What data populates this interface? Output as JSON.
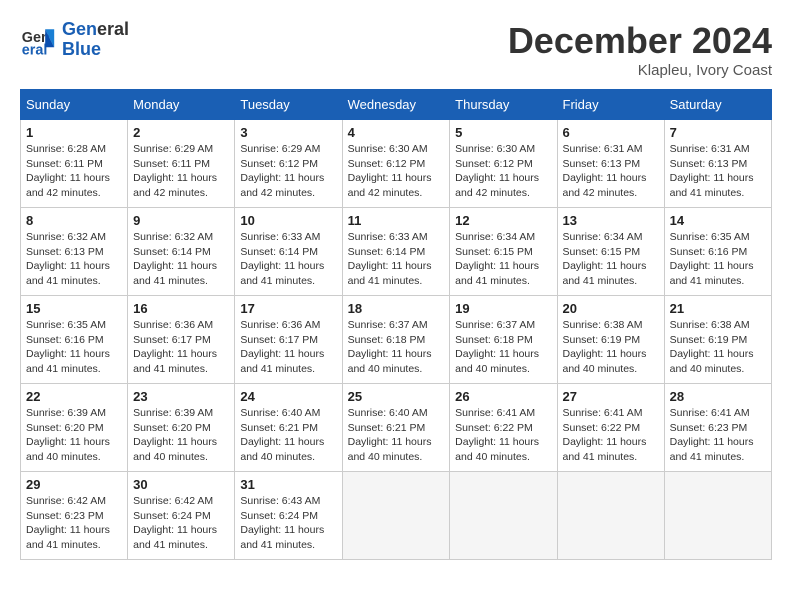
{
  "header": {
    "logo_line1": "General",
    "logo_line2": "Blue",
    "month_title": "December 2024",
    "location": "Klapleu, Ivory Coast"
  },
  "weekdays": [
    "Sunday",
    "Monday",
    "Tuesday",
    "Wednesday",
    "Thursday",
    "Friday",
    "Saturday"
  ],
  "weeks": [
    [
      {
        "day": "1",
        "info": "Sunrise: 6:28 AM\nSunset: 6:11 PM\nDaylight: 11 hours\nand 42 minutes."
      },
      {
        "day": "2",
        "info": "Sunrise: 6:29 AM\nSunset: 6:11 PM\nDaylight: 11 hours\nand 42 minutes."
      },
      {
        "day": "3",
        "info": "Sunrise: 6:29 AM\nSunset: 6:12 PM\nDaylight: 11 hours\nand 42 minutes."
      },
      {
        "day": "4",
        "info": "Sunrise: 6:30 AM\nSunset: 6:12 PM\nDaylight: 11 hours\nand 42 minutes."
      },
      {
        "day": "5",
        "info": "Sunrise: 6:30 AM\nSunset: 6:12 PM\nDaylight: 11 hours\nand 42 minutes."
      },
      {
        "day": "6",
        "info": "Sunrise: 6:31 AM\nSunset: 6:13 PM\nDaylight: 11 hours\nand 42 minutes."
      },
      {
        "day": "7",
        "info": "Sunrise: 6:31 AM\nSunset: 6:13 PM\nDaylight: 11 hours\nand 41 minutes."
      }
    ],
    [
      {
        "day": "8",
        "info": "Sunrise: 6:32 AM\nSunset: 6:13 PM\nDaylight: 11 hours\nand 41 minutes."
      },
      {
        "day": "9",
        "info": "Sunrise: 6:32 AM\nSunset: 6:14 PM\nDaylight: 11 hours\nand 41 minutes."
      },
      {
        "day": "10",
        "info": "Sunrise: 6:33 AM\nSunset: 6:14 PM\nDaylight: 11 hours\nand 41 minutes."
      },
      {
        "day": "11",
        "info": "Sunrise: 6:33 AM\nSunset: 6:14 PM\nDaylight: 11 hours\nand 41 minutes."
      },
      {
        "day": "12",
        "info": "Sunrise: 6:34 AM\nSunset: 6:15 PM\nDaylight: 11 hours\nand 41 minutes."
      },
      {
        "day": "13",
        "info": "Sunrise: 6:34 AM\nSunset: 6:15 PM\nDaylight: 11 hours\nand 41 minutes."
      },
      {
        "day": "14",
        "info": "Sunrise: 6:35 AM\nSunset: 6:16 PM\nDaylight: 11 hours\nand 41 minutes."
      }
    ],
    [
      {
        "day": "15",
        "info": "Sunrise: 6:35 AM\nSunset: 6:16 PM\nDaylight: 11 hours\nand 41 minutes."
      },
      {
        "day": "16",
        "info": "Sunrise: 6:36 AM\nSunset: 6:17 PM\nDaylight: 11 hours\nand 41 minutes."
      },
      {
        "day": "17",
        "info": "Sunrise: 6:36 AM\nSunset: 6:17 PM\nDaylight: 11 hours\nand 41 minutes."
      },
      {
        "day": "18",
        "info": "Sunrise: 6:37 AM\nSunset: 6:18 PM\nDaylight: 11 hours\nand 40 minutes."
      },
      {
        "day": "19",
        "info": "Sunrise: 6:37 AM\nSunset: 6:18 PM\nDaylight: 11 hours\nand 40 minutes."
      },
      {
        "day": "20",
        "info": "Sunrise: 6:38 AM\nSunset: 6:19 PM\nDaylight: 11 hours\nand 40 minutes."
      },
      {
        "day": "21",
        "info": "Sunrise: 6:38 AM\nSunset: 6:19 PM\nDaylight: 11 hours\nand 40 minutes."
      }
    ],
    [
      {
        "day": "22",
        "info": "Sunrise: 6:39 AM\nSunset: 6:20 PM\nDaylight: 11 hours\nand 40 minutes."
      },
      {
        "day": "23",
        "info": "Sunrise: 6:39 AM\nSunset: 6:20 PM\nDaylight: 11 hours\nand 40 minutes."
      },
      {
        "day": "24",
        "info": "Sunrise: 6:40 AM\nSunset: 6:21 PM\nDaylight: 11 hours\nand 40 minutes."
      },
      {
        "day": "25",
        "info": "Sunrise: 6:40 AM\nSunset: 6:21 PM\nDaylight: 11 hours\nand 40 minutes."
      },
      {
        "day": "26",
        "info": "Sunrise: 6:41 AM\nSunset: 6:22 PM\nDaylight: 11 hours\nand 40 minutes."
      },
      {
        "day": "27",
        "info": "Sunrise: 6:41 AM\nSunset: 6:22 PM\nDaylight: 11 hours\nand 41 minutes."
      },
      {
        "day": "28",
        "info": "Sunrise: 6:41 AM\nSunset: 6:23 PM\nDaylight: 11 hours\nand 41 minutes."
      }
    ],
    [
      {
        "day": "29",
        "info": "Sunrise: 6:42 AM\nSunset: 6:23 PM\nDaylight: 11 hours\nand 41 minutes."
      },
      {
        "day": "30",
        "info": "Sunrise: 6:42 AM\nSunset: 6:24 PM\nDaylight: 11 hours\nand 41 minutes."
      },
      {
        "day": "31",
        "info": "Sunrise: 6:43 AM\nSunset: 6:24 PM\nDaylight: 11 hours\nand 41 minutes."
      },
      {
        "day": "",
        "info": ""
      },
      {
        "day": "",
        "info": ""
      },
      {
        "day": "",
        "info": ""
      },
      {
        "day": "",
        "info": ""
      }
    ]
  ]
}
